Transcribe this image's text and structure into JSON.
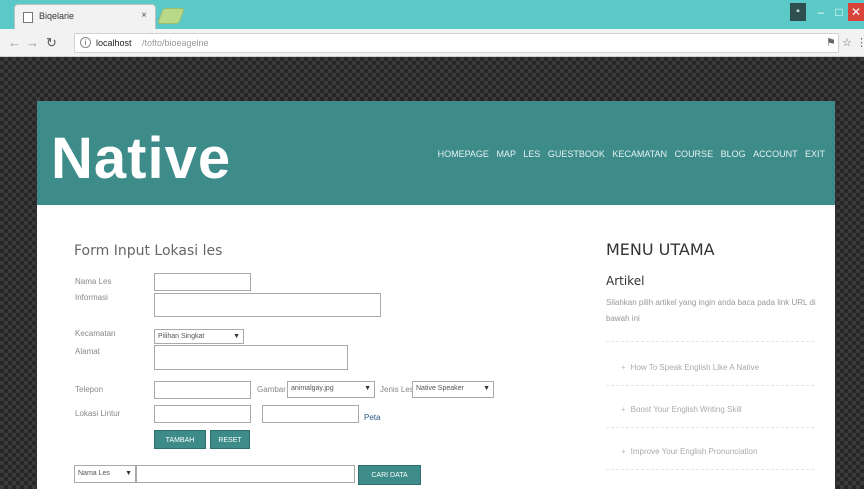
{
  "browser": {
    "tab_title": "Biqelarie",
    "url_host": "localhost",
    "url_path": "/tofto/bioeagelne"
  },
  "site": {
    "logo": "Native",
    "nav": [
      "HOMEPAGE",
      "MAP",
      "LES",
      "GUESTBOOK",
      "KECAMATAN",
      "COURSE",
      "BLOG",
      "ACCOUNT",
      "EXIT"
    ]
  },
  "form": {
    "title": "Form Input Lokasi les",
    "labels": {
      "nama_les": "Nama Les",
      "informasi": "Informasi",
      "kecamatan": "Kecamatan",
      "alamat": "Alamat",
      "telepon": "Telepon",
      "lokasi": "Lokasi Lintur"
    },
    "kecamatan_selected": "Pilihan Singkat",
    "gambar_label": "Gambar",
    "gambar_selected": "animalgay.jpg",
    "jenis_label": "Jenis Les",
    "jenis_selected": "Native Speaker",
    "peta_link": "Peta",
    "tambah_button": "TAMBAH",
    "reset_button": "RESET"
  },
  "search": {
    "field_selected": "Nama Les",
    "button": "CARI DATA"
  },
  "sidebar": {
    "title": "MENU UTAMA",
    "subtitle": "Artikel",
    "description": "Silahkan pilih artikel yang ingin anda baca pada link URL di bawah ini",
    "links": [
      "How To Speak English Like A Native",
      "Boost Your English Writing Skill",
      "Improve Your English Pronunciation"
    ]
  }
}
